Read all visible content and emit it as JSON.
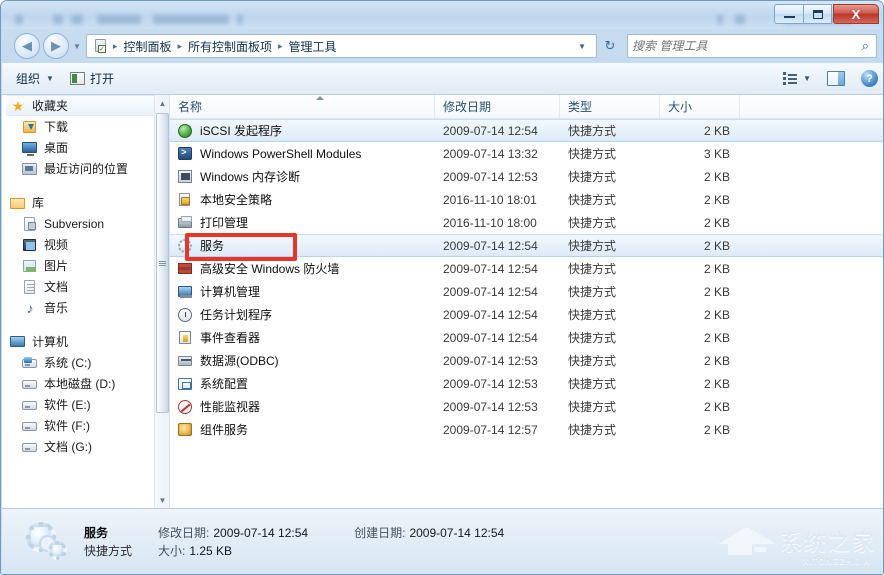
{
  "window": {
    "controls": {
      "minimize": "—",
      "maximize": "□",
      "close": "X"
    }
  },
  "address": {
    "back_glyph": "◀",
    "forward_glyph": "▶",
    "history_caret": "▼",
    "crumb_icon": "control-panel-icon",
    "crumbs": [
      "控制面板",
      "所有控制面板项",
      "管理工具"
    ],
    "separator": "▸",
    "dropdown_caret": "▼",
    "refresh_glyph": "↻"
  },
  "search": {
    "placeholder": "搜索 管理工具",
    "value": "",
    "icon": "⌕"
  },
  "toolbar": {
    "organize_label": "组织",
    "organize_caret": "▼",
    "open_label": "打开",
    "view_caret": "▼",
    "help_label": "?"
  },
  "sidebar": {
    "groups": [
      {
        "header": {
          "label": "收藏夹",
          "icon": "star-icon",
          "selected": true
        },
        "items": [
          {
            "label": "下载",
            "icon": "downloads-icon"
          },
          {
            "label": "桌面",
            "icon": "desktop-icon"
          },
          {
            "label": "最近访问的位置",
            "icon": "recent-places-icon"
          }
        ]
      },
      {
        "header": {
          "label": "库",
          "icon": "library-icon",
          "selected": false
        },
        "items": [
          {
            "label": "Subversion",
            "icon": "subversion-icon"
          },
          {
            "label": "视频",
            "icon": "videos-icon"
          },
          {
            "label": "图片",
            "icon": "pictures-icon"
          },
          {
            "label": "文档",
            "icon": "documents-icon"
          },
          {
            "label": "音乐",
            "icon": "music-icon"
          }
        ]
      },
      {
        "header": {
          "label": "计算机",
          "icon": "computer-icon",
          "selected": false
        },
        "items": [
          {
            "label": "系统 (C:)",
            "icon": "system-drive-icon"
          },
          {
            "label": "本地磁盘 (D:)",
            "icon": "drive-icon"
          },
          {
            "label": "软件 (E:)",
            "icon": "drive-icon"
          },
          {
            "label": "软件 (F:)",
            "icon": "drive-icon"
          },
          {
            "label": "文档 (G:)",
            "icon": "drive-icon"
          }
        ]
      }
    ],
    "scrollbar": {
      "up_glyph": "▲",
      "down_glyph": "▼"
    }
  },
  "filelist": {
    "columns": [
      {
        "key": "name",
        "label": "名称",
        "sorted": "asc"
      },
      {
        "key": "date",
        "label": "修改日期"
      },
      {
        "key": "type",
        "label": "类型"
      },
      {
        "key": "size",
        "label": "大小"
      }
    ],
    "rows": [
      {
        "name": "iSCSI 发起程序",
        "date": "2009-07-14 12:54",
        "type": "快捷方式",
        "size": "2 KB",
        "icon": "iscsi-icon",
        "selected": true
      },
      {
        "name": "Windows PowerShell Modules",
        "date": "2009-07-14 13:32",
        "type": "快捷方式",
        "size": "3 KB",
        "icon": "powershell-icon",
        "selected": false
      },
      {
        "name": "Windows 内存诊断",
        "date": "2009-07-14 12:53",
        "type": "快捷方式",
        "size": "2 KB",
        "icon": "memory-diagnostic-icon",
        "selected": false
      },
      {
        "name": "本地安全策略",
        "date": "2016-11-10 18:01",
        "type": "快捷方式",
        "size": "2 KB",
        "icon": "local-security-policy-icon",
        "selected": false
      },
      {
        "name": "打印管理",
        "date": "2016-11-10 18:00",
        "type": "快捷方式",
        "size": "2 KB",
        "icon": "print-management-icon",
        "selected": false
      },
      {
        "name": "服务",
        "date": "2009-07-14 12:54",
        "type": "快捷方式",
        "size": "2 KB",
        "icon": "services-icon",
        "selected": true,
        "highlighted": true
      },
      {
        "name": "高级安全 Windows 防火墙",
        "date": "2009-07-14 12:54",
        "type": "快捷方式",
        "size": "2 KB",
        "icon": "firewall-icon",
        "selected": false
      },
      {
        "name": "计算机管理",
        "date": "2009-07-14 12:54",
        "type": "快捷方式",
        "size": "2 KB",
        "icon": "computer-management-icon",
        "selected": false
      },
      {
        "name": "任务计划程序",
        "date": "2009-07-14 12:54",
        "type": "快捷方式",
        "size": "2 KB",
        "icon": "task-scheduler-icon",
        "selected": false
      },
      {
        "name": "事件查看器",
        "date": "2009-07-14 12:54",
        "type": "快捷方式",
        "size": "2 KB",
        "icon": "event-viewer-icon",
        "selected": false
      },
      {
        "name": "数据源(ODBC)",
        "date": "2009-07-14 12:53",
        "type": "快捷方式",
        "size": "2 KB",
        "icon": "odbc-icon",
        "selected": false
      },
      {
        "name": "系统配置",
        "date": "2009-07-14 12:53",
        "type": "快捷方式",
        "size": "2 KB",
        "icon": "system-configuration-icon",
        "selected": false
      },
      {
        "name": "性能监视器",
        "date": "2009-07-14 12:53",
        "type": "快捷方式",
        "size": "2 KB",
        "icon": "performance-monitor-icon",
        "selected": false
      },
      {
        "name": "组件服务",
        "date": "2009-07-14 12:57",
        "type": "快捷方式",
        "size": "2 KB",
        "icon": "component-services-icon",
        "selected": false
      }
    ]
  },
  "details": {
    "icon": "services-gears-icon",
    "name": "服务",
    "type": "快捷方式",
    "modified_label": "修改日期:",
    "modified_value": "2009-07-14 12:54",
    "created_label": "创建日期:",
    "created_value": "2009-07-14 12:54",
    "size_label": "大小:",
    "size_value": "1.25 KB"
  },
  "watermark": {
    "text": "系统之家",
    "subtext": "XITONGZHIJIA"
  },
  "colors": {
    "accent": "#2a6fa8",
    "highlight_box": "#e8352a",
    "selection": "#dceaf8",
    "close_button": "#b9372b"
  }
}
